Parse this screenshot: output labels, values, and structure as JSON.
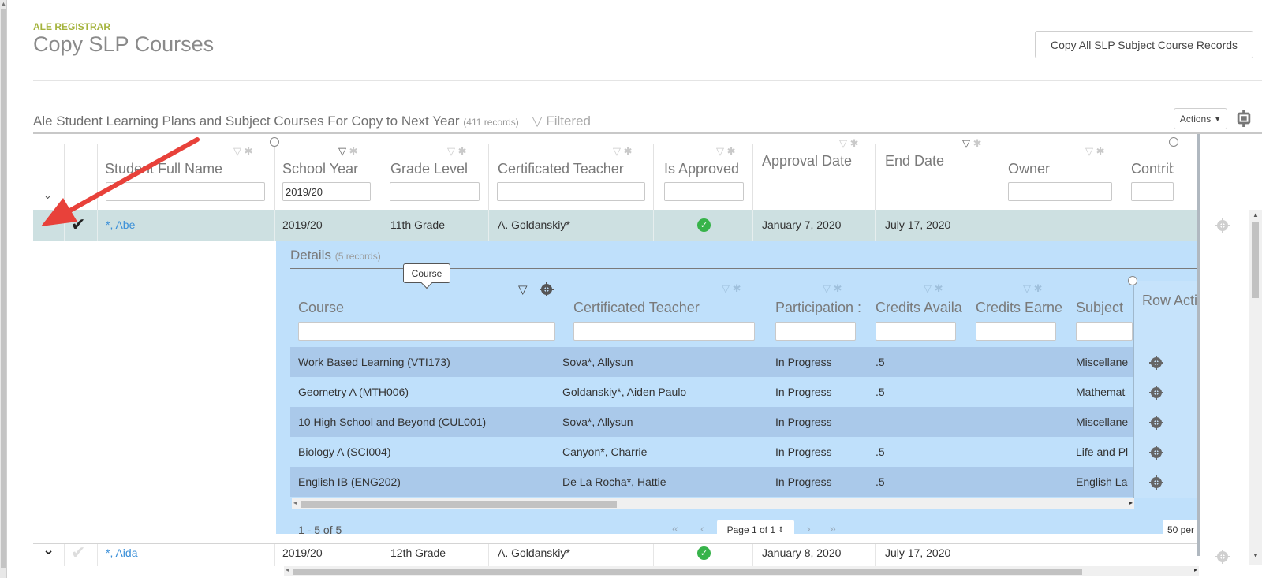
{
  "header": {
    "category": "ALE REGISTRAR",
    "title": "Copy SLP Courses",
    "copy_all_label": "Copy All SLP Subject Course Records"
  },
  "grid": {
    "title": "Ale Student Learning Plans and Subject Courses For Copy to Next Year",
    "record_count": "(411 records)",
    "filtered_label": "Filtered",
    "actions_label": "Actions",
    "columns": [
      {
        "label": "Student Full Name",
        "filter": ""
      },
      {
        "label": "School Year",
        "filter": "2019/20"
      },
      {
        "label": "Grade Level",
        "filter": ""
      },
      {
        "label": "Certificated Teacher",
        "filter": ""
      },
      {
        "label": "Is Approved",
        "filter": ""
      },
      {
        "label": "Approval Date"
      },
      {
        "label": "End Date"
      },
      {
        "label": "Owner",
        "filter": ""
      },
      {
        "label": "Contrib",
        "filter": ""
      }
    ],
    "rows": [
      {
        "name": "*, Abe",
        "school_year": "2019/20",
        "grade": "11th Grade",
        "teacher": "A. Goldanskiy*",
        "approved": true,
        "approval_date": "January 7, 2020",
        "end_date": "July 17, 2020",
        "expanded": true,
        "checked": true
      },
      {
        "name": "*, Aida",
        "school_year": "2019/20",
        "grade": "12th Grade",
        "teacher": "A. Goldanskiy*",
        "approved": true,
        "approval_date": "January 8, 2020",
        "end_date": "July 17, 2020",
        "expanded": false,
        "checked": false
      }
    ]
  },
  "details": {
    "title": "Details",
    "record_count": "(5 records)",
    "tooltip": "Course",
    "columns": [
      "Course",
      "Certificated Teacher",
      "Participation :",
      "Credits Availa",
      "Credits Earne",
      "Subject",
      "Row Acti"
    ],
    "rows": [
      {
        "course": "Work Based Learning (VTI173)",
        "teacher": "Sova*, Allysun",
        "participation": "In Progress",
        "credits_avail": ".5",
        "credits_earned": "",
        "subject": "Miscellane"
      },
      {
        "course": "Geometry A (MTH006)",
        "teacher": "Goldanskiy*, Aiden Paulo",
        "participation": "In Progress",
        "credits_avail": ".5",
        "credits_earned": "",
        "subject": "Mathemat"
      },
      {
        "course": "10 High School and Beyond (CUL001)",
        "teacher": "Sova*, Allysun",
        "participation": "In Progress",
        "credits_avail": "",
        "credits_earned": "",
        "subject": "Miscellane"
      },
      {
        "course": "Biology A (SCI004)",
        "teacher": "Canyon*, Charrie",
        "participation": "In Progress",
        "credits_avail": ".5",
        "credits_earned": "",
        "subject": "Life and Pl"
      },
      {
        "course": "English IB (ENG202)",
        "teacher": "De La Rocha*, Hattie",
        "participation": "In Progress",
        "credits_avail": ".5",
        "credits_earned": "",
        "subject": "English La"
      }
    ],
    "pager": {
      "range": "1 - 5 of 5",
      "page_label": "Page 1 of 1",
      "per_page_label": "50 per"
    }
  },
  "annotation": {
    "arrow_color": "#e8413a"
  }
}
